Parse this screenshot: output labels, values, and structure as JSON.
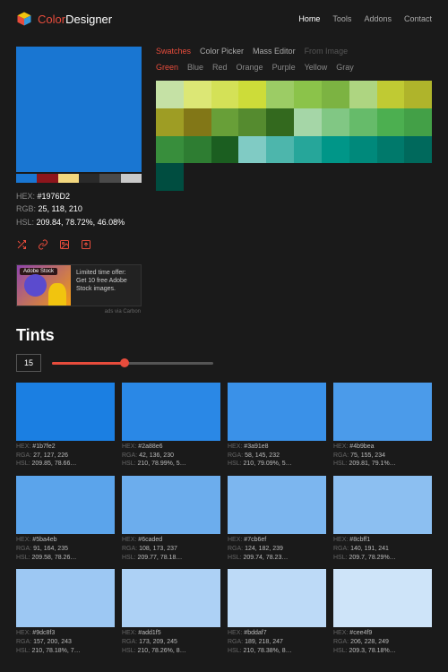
{
  "header": {
    "brand_1": "Color",
    "brand_2": "Designer",
    "nav": [
      "Home",
      "Tools",
      "Addons",
      "Contact"
    ],
    "nav_active": 0
  },
  "preview": {
    "color": "#1976D2",
    "palette": [
      "#1976D2",
      "#8d151c",
      "#f2d77e",
      "#2a2a2a",
      "#4a4a4a",
      "#c9c9c9"
    ],
    "hex_label": "HEX:",
    "hex_value": "#1976D2",
    "rgb_label": "RGB:",
    "rgb_value": "25, 118, 210",
    "hsl_label": "HSL:",
    "hsl_value": "209.84, 78.72%, 46.08%"
  },
  "ad": {
    "badge": "Adobe Stock",
    "text": "Limited time offer: Get 10 free Adobe Stock images.",
    "tag": "ads via Carbon"
  },
  "tabs": {
    "items": [
      "Swatches",
      "Color Picker",
      "Mass Editor",
      "From Image"
    ],
    "active": 0,
    "disabled": [
      3
    ]
  },
  "ctabs": {
    "items": [
      "Green",
      "Blue",
      "Red",
      "Orange",
      "Purple",
      "Yellow",
      "Gray"
    ],
    "active": 0
  },
  "swatch_grid": [
    "#c5e1a5",
    "#dce775",
    "#d4e157",
    "#cddc39",
    "#9ccc65",
    "#8bc34a",
    "#7cb342",
    "#aed581",
    "#c0ca33",
    "#afb42b",
    "#9e9d24",
    "#827717",
    "#689f38",
    "#558b2f",
    "#33691e",
    "#a5d6a7",
    "#81c784",
    "#66bb6a",
    "#4caf50",
    "#43a047",
    "#388e3c",
    "#2e7d32",
    "#1b5e20",
    "#80cbc4",
    "#4db6ac",
    "#26a69a",
    "#009688",
    "#00897b",
    "#00796b",
    "#00695c",
    "#004d40"
  ],
  "tints": {
    "title": "Tints",
    "count": "15",
    "slider_pct": 45,
    "items": [
      {
        "c": "#1b7fe2",
        "hex": "#1b7fe2",
        "rgb": "27, 127, 226",
        "hsl": "209.85, 78.66…"
      },
      {
        "c": "#2a88e6",
        "hex": "#2a88e6",
        "rgb": "42, 136, 230",
        "hsl": "210, 78.99%, 5…"
      },
      {
        "c": "#3a91e8",
        "hex": "#3a91e8",
        "rgb": "58, 145, 232",
        "hsl": "210, 79.09%, 5…"
      },
      {
        "c": "#4b9bea",
        "hex": "#4b9bea",
        "rgb": "75, 155, 234",
        "hsl": "209.81, 79.1%…"
      },
      {
        "c": "#5ba4eb",
        "hex": "#5ba4eb",
        "rgb": "91, 164, 235",
        "hsl": "209.58, 78.26…"
      },
      {
        "c": "#6caded",
        "hex": "#6caded",
        "rgb": "108, 173, 237",
        "hsl": "209.77, 78.18…"
      },
      {
        "c": "#7cb6ef",
        "hex": "#7cb6ef",
        "rgb": "124, 182, 239",
        "hsl": "209.74, 78.23…"
      },
      {
        "c": "#8cbff1",
        "hex": "#8cbff1",
        "rgb": "140, 191, 241",
        "hsl": "209.7, 78.29%…"
      },
      {
        "c": "#9dc8f3",
        "hex": "#9dc8f3",
        "rgb": "157, 200, 243",
        "hsl": "210, 78.18%, 7…"
      },
      {
        "c": "#add1f5",
        "hex": "#add1f5",
        "rgb": "173, 209, 245",
        "hsl": "210, 78.26%, 8…"
      },
      {
        "c": "#bddaf7",
        "hex": "#bddaf7",
        "rgb": "189, 218, 247",
        "hsl": "210, 78.38%, 8…"
      },
      {
        "c": "#cee4f9",
        "hex": "#cee4f9",
        "rgb": "206, 228, 249",
        "hsl": "209.3, 78.18%…"
      }
    ]
  }
}
